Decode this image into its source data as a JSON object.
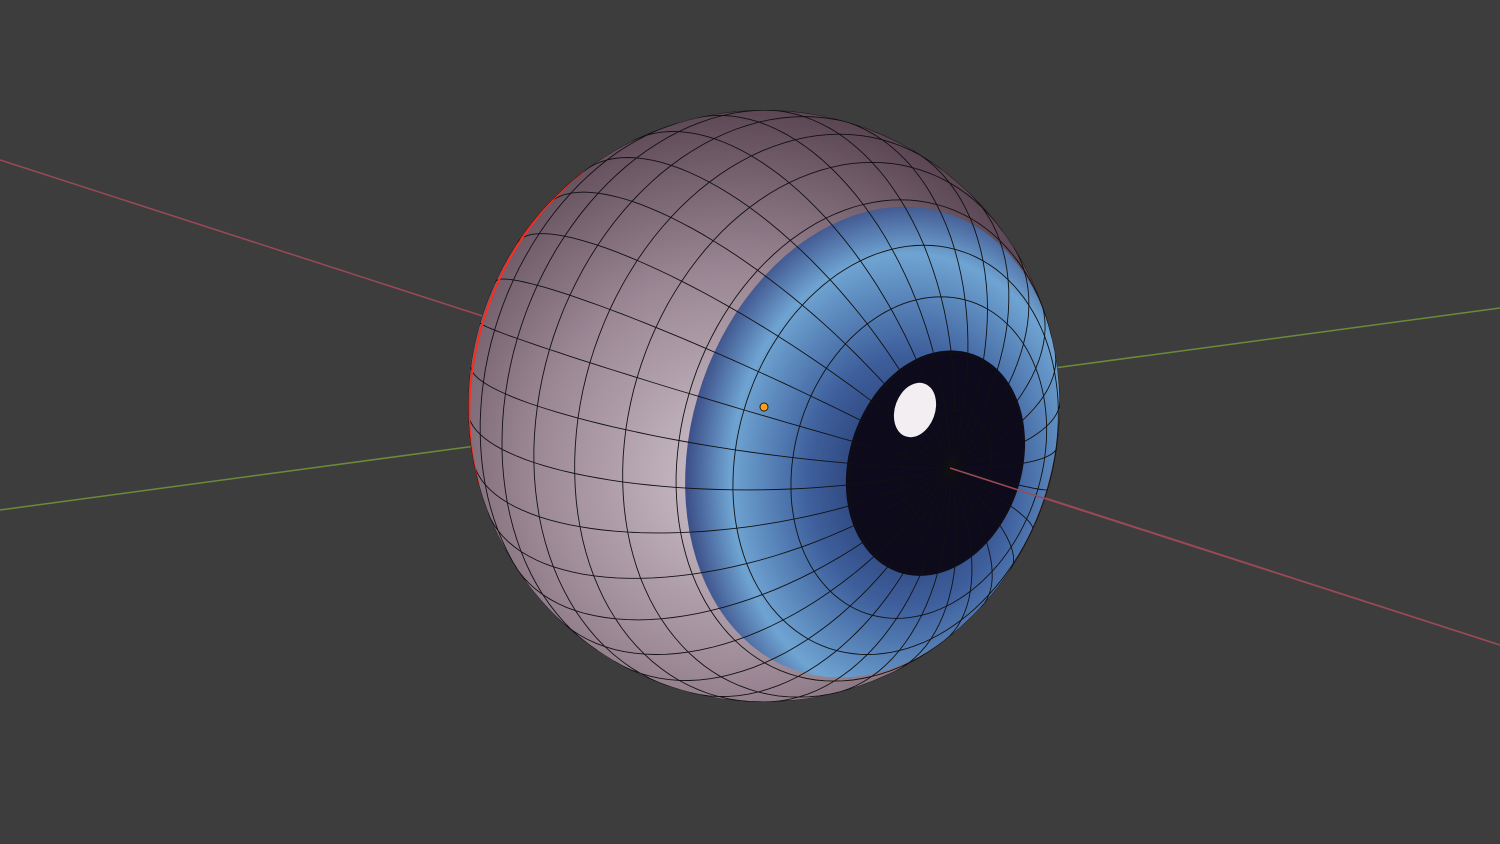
{
  "viewport": {
    "background": "#3d3d3d",
    "axis_x_color": "#9a4a55",
    "axis_y_color": "#6b8a3a",
    "object": "eyeball",
    "sclera_color": "#c9bcc6",
    "iris_color": "#5b8cc4",
    "pupil_color": "#0d0a1c",
    "seam_color": "#ff2a1a",
    "origin_color": "#ffa020",
    "wire_color": "#111111"
  }
}
